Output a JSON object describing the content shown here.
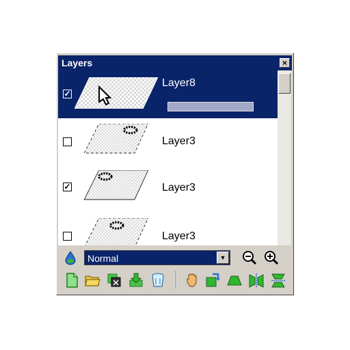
{
  "panel": {
    "title": "Layers",
    "close_label": "×"
  },
  "layers": [
    {
      "name": "Layer8",
      "visible": true,
      "selected": true
    },
    {
      "name": "Layer3",
      "visible": false,
      "selected": false
    },
    {
      "name": "Layer3",
      "visible": true,
      "selected": false
    },
    {
      "name": "Layer3",
      "visible": false,
      "selected": false
    }
  ],
  "blend_mode": {
    "selected": "Normal"
  },
  "icons": {
    "blend": "water-drop-icon",
    "zoom_out": "zoom-out-icon",
    "zoom_in": "zoom-in-icon",
    "new_layer": "new-document-icon",
    "open": "open-folder-icon",
    "merge": "merge-layer-icon",
    "import": "import-down-icon",
    "delete": "trash-icon",
    "hand": "hand-icon",
    "rotate": "rotate-icon",
    "perspective": "trapezoid-icon",
    "flip_h": "flip-horizontal-icon",
    "flip_v": "flip-vertical-icon"
  },
  "colors": {
    "selection": "#0a246a",
    "panel": "#d4d0c8",
    "icon_green": "#2fb82f"
  }
}
